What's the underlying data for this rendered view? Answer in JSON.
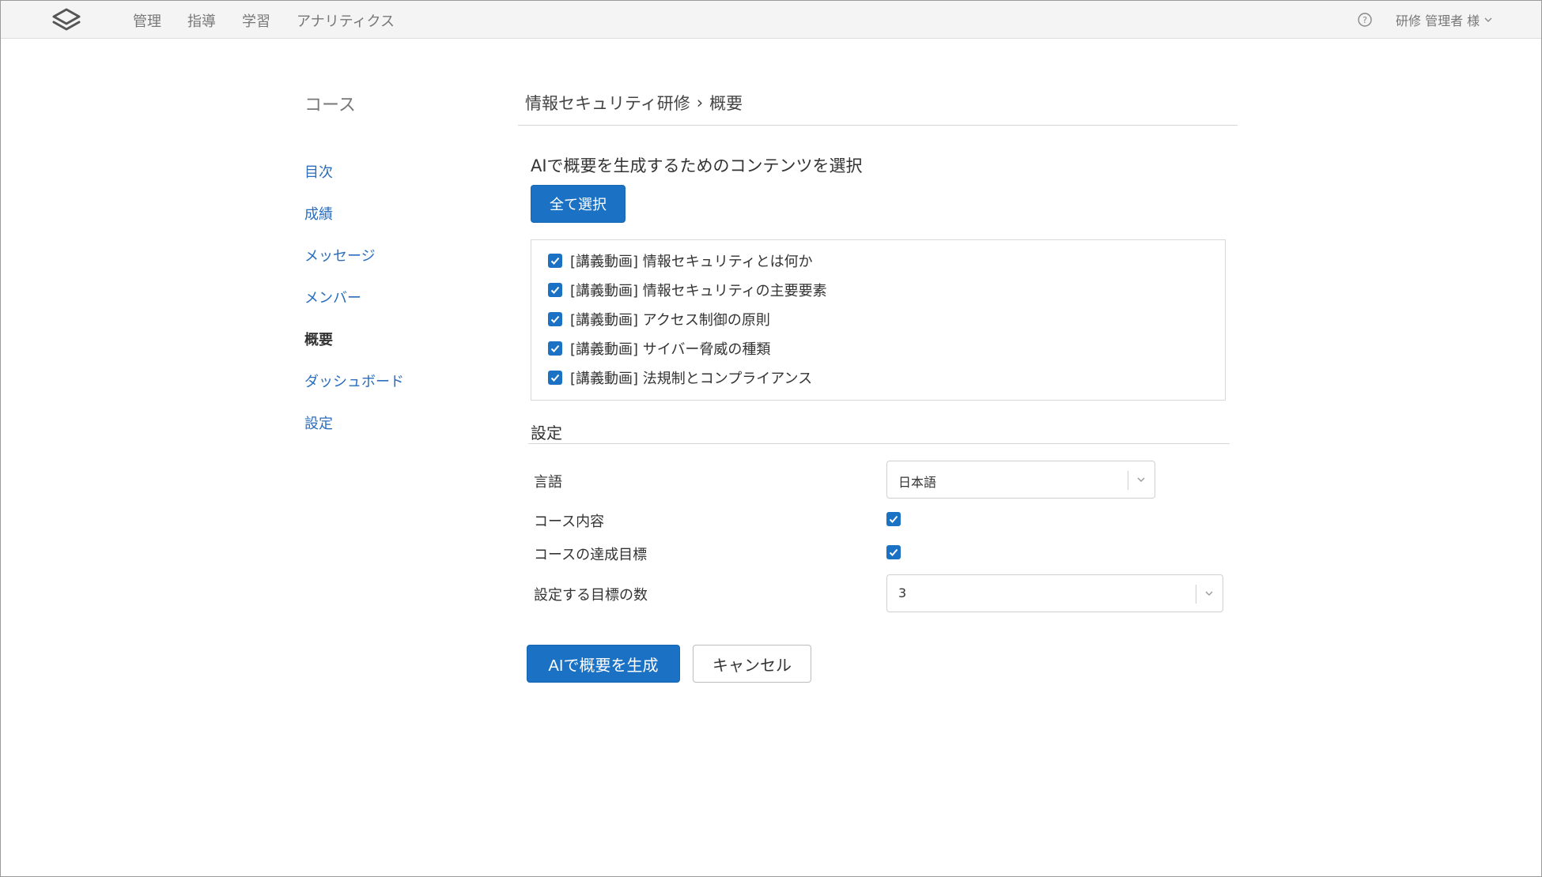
{
  "topbar": {
    "nav": [
      "管理",
      "指導",
      "学習",
      "アナリティクス"
    ],
    "user_label": "研修 管理者 様"
  },
  "sidebar": {
    "title": "コース",
    "items": [
      {
        "label": "目次",
        "active": false
      },
      {
        "label": "成績",
        "active": false
      },
      {
        "label": "メッセージ",
        "active": false
      },
      {
        "label": "メンバー",
        "active": false
      },
      {
        "label": "概要",
        "active": true
      },
      {
        "label": "ダッシュボード",
        "active": false
      },
      {
        "label": "設定",
        "active": false
      }
    ]
  },
  "breadcrumb": {
    "course": "情報セキュリティ研修",
    "separator": "›",
    "current": "概要"
  },
  "content_select": {
    "heading": "AIで概要を生成するためのコンテンツを選択",
    "select_all_label": "全て選択",
    "items": [
      {
        "label": "[講義動画] 情報セキュリティとは何か",
        "checked": true
      },
      {
        "label": "[講義動画] 情報セキュリティの主要要素",
        "checked": true
      },
      {
        "label": "[講義動画] アクセス制御の原則",
        "checked": true
      },
      {
        "label": "[講義動画] サイバー脅威の種類",
        "checked": true
      },
      {
        "label": "[講義動画] 法規制とコンプライアンス",
        "checked": true
      }
    ]
  },
  "settings": {
    "title": "設定",
    "language": {
      "label": "言語",
      "value": "日本語"
    },
    "course_content": {
      "label": "コース内容",
      "checked": true
    },
    "course_goals": {
      "label": "コースの達成目標",
      "checked": true
    },
    "goal_count": {
      "label": "設定する目標の数",
      "value": "3"
    }
  },
  "actions": {
    "generate_label": "AIで概要を生成",
    "cancel_label": "キャンセル"
  },
  "colors": {
    "accent": "#1b71c4",
    "link": "#2a6ebd",
    "topbar_bg": "#f4f4f5"
  },
  "icons": {
    "logo": "layers-logo-icon",
    "help": "question-circle-icon",
    "chevron": "chevron-down-icon",
    "check": "checkmark-icon"
  }
}
